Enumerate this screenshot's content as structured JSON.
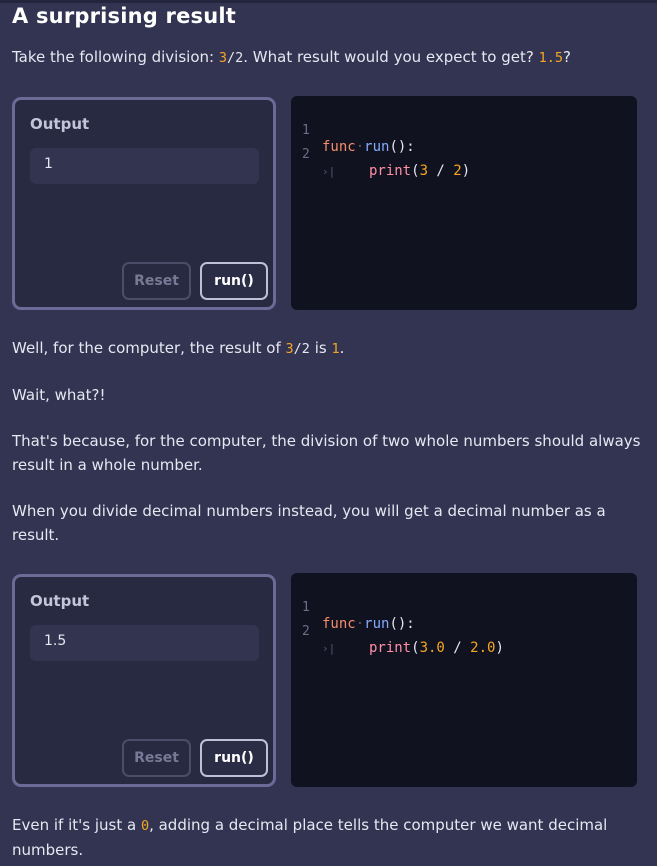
{
  "page": {
    "title": "A surprising result"
  },
  "intro": {
    "prefix": "Take the following division: ",
    "expr_a": "3",
    "expr_op": "/2",
    "middle": ". What result would you expect to get? ",
    "expected": "1.5",
    "suffix": "?"
  },
  "example1": {
    "output_title": "Output",
    "output_value": "1",
    "reset_label": "Reset",
    "run_label": "run()",
    "code_lines": [
      {
        "num": "1",
        "kw": "func",
        "name": "run",
        "rest": "():"
      },
      {
        "num": "2",
        "call": "print",
        "args_open": "(",
        "a": "3",
        "op": " / ",
        "b": "2",
        "args_close": ")"
      }
    ]
  },
  "para_result": {
    "prefix": "Well, for the computer, the result of ",
    "expr_a": "3",
    "expr_op": "/2",
    "middle": " is ",
    "value": "1",
    "suffix": "."
  },
  "para_wait": "Wait, what?!",
  "para_because": "That's because, for the computer, the division of two whole numbers should always result in a whole number.",
  "para_decimal": "When you divide decimal numbers instead, you will get a decimal number as a result.",
  "example2": {
    "output_title": "Output",
    "output_value": "1.5",
    "reset_label": "Reset",
    "run_label": "run()",
    "code_lines": [
      {
        "num": "1",
        "kw": "func",
        "name": "run",
        "rest": "():"
      },
      {
        "num": "2",
        "call": "print",
        "args_open": "(",
        "a": "3.0",
        "op": " / ",
        "b": "2.0",
        "args_close": ")"
      }
    ]
  },
  "para_final": {
    "prefix": "Even if it's just a ",
    "zero": "0",
    "suffix": ", adding a decimal place tells the computer we want decimal numbers."
  },
  "colors": {
    "background": "#333452",
    "number_accent": "#f5a623",
    "keyword": "#f78c6c",
    "function_name": "#82aaff",
    "call": "#ff8fa3",
    "editor_bg": "#11121f",
    "output_border": "#6c6a96"
  }
}
